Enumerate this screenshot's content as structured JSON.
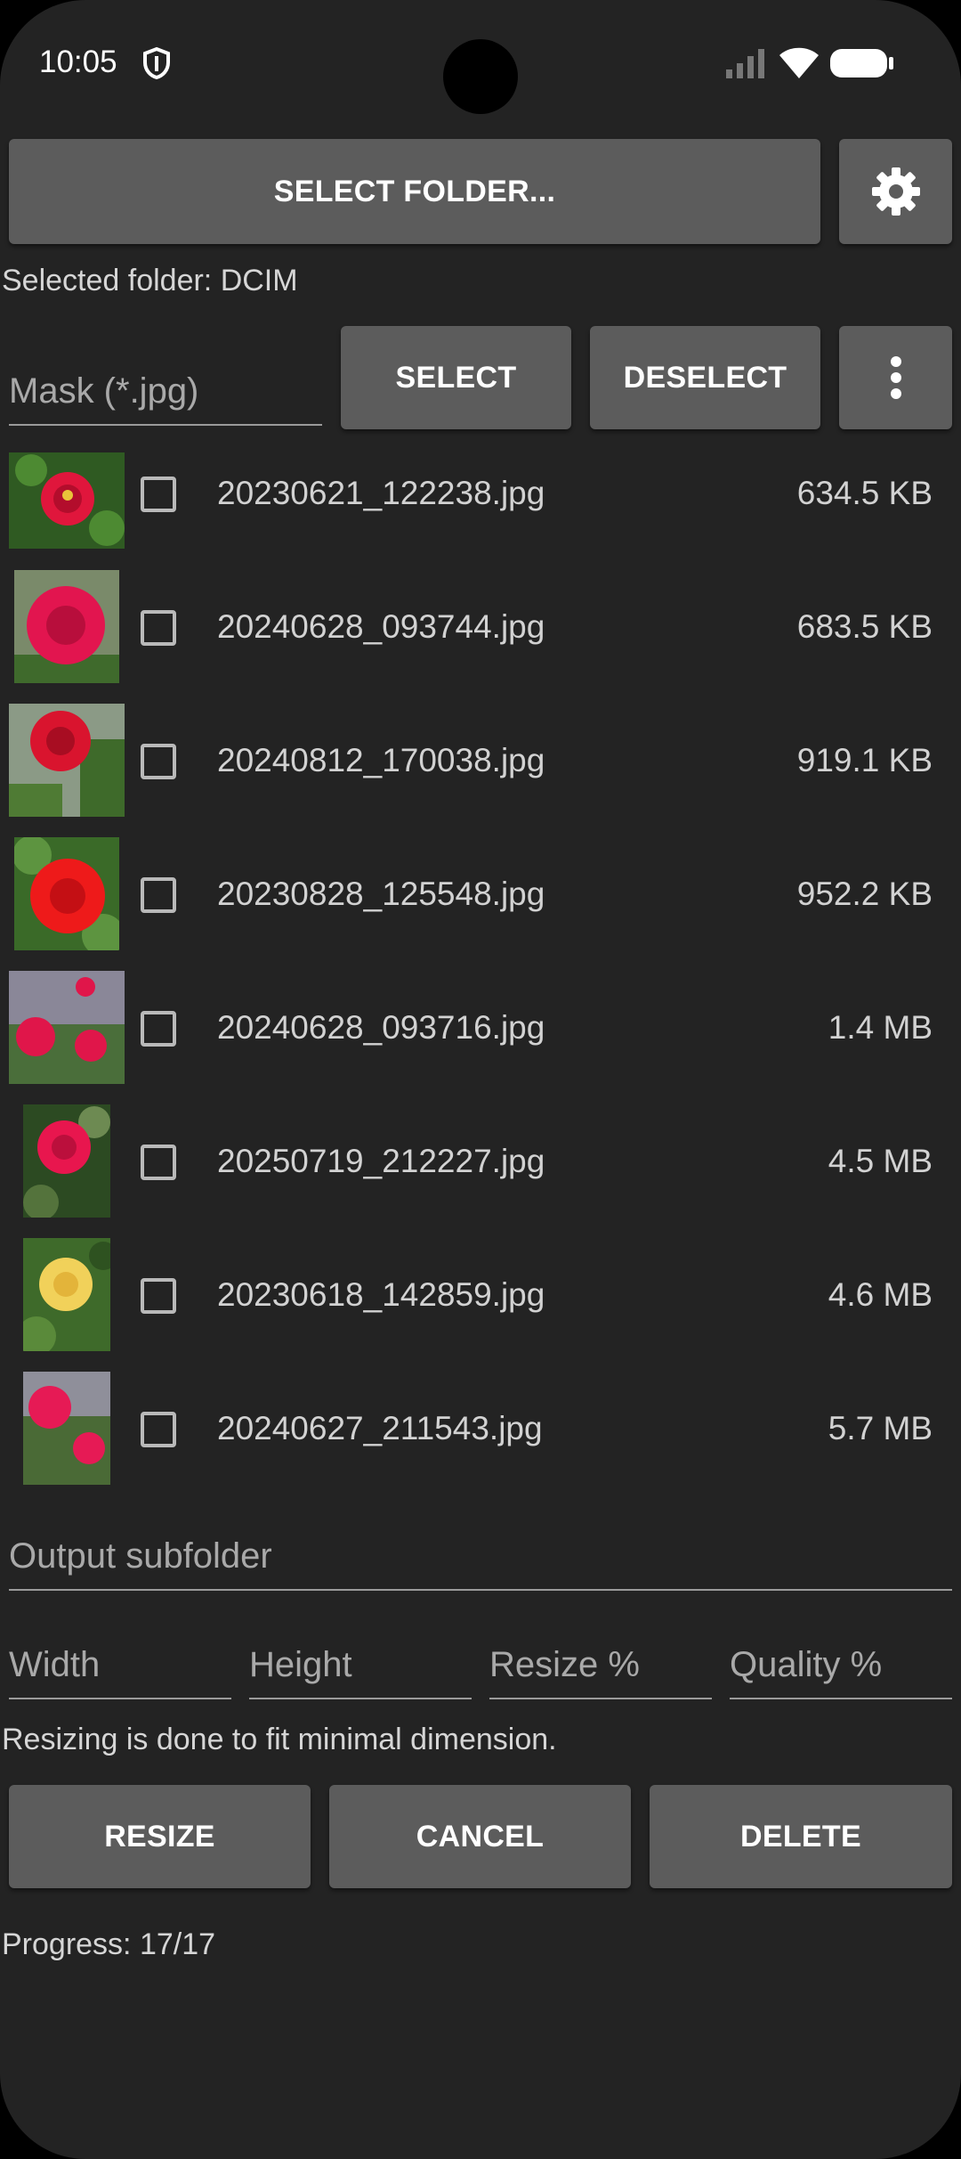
{
  "status_bar": {
    "time": "10:05"
  },
  "toolbar": {
    "select_folder_label": "SELECT FOLDER..."
  },
  "selected_folder_text": "Selected folder: DCIM",
  "mask": {
    "placeholder": "Mask (*.jpg)"
  },
  "buttons": {
    "select": "SELECT",
    "deselect": "DESELECT"
  },
  "files": [
    {
      "name": "20230621_122238.jpg",
      "size": "634.5 KB",
      "checked": false
    },
    {
      "name": "20240628_093744.jpg",
      "size": "683.5 KB",
      "checked": false
    },
    {
      "name": "20240812_170038.jpg",
      "size": "919.1 KB",
      "checked": false
    },
    {
      "name": "20230828_125548.jpg",
      "size": "952.2 KB",
      "checked": false
    },
    {
      "name": "20240628_093716.jpg",
      "size": "1.4 MB",
      "checked": false
    },
    {
      "name": "20250719_212227.jpg",
      "size": "4.5 MB",
      "checked": false
    },
    {
      "name": "20230618_142859.jpg",
      "size": "4.6 MB",
      "checked": false
    },
    {
      "name": "20240627_211543.jpg",
      "size": "5.7 MB",
      "checked": false
    }
  ],
  "output": {
    "subfolder_placeholder": "Output subfolder"
  },
  "params": {
    "width": "Width",
    "height": "Height",
    "resize": "Resize %",
    "quality": "Quality %"
  },
  "hint_text": "Resizing is done to fit minimal dimension.",
  "actions": {
    "resize": "RESIZE",
    "cancel": "CANCEL",
    "delete": "DELETE"
  },
  "progress_text": "Progress: 17/17",
  "colors": {
    "background": "#232323",
    "button": "#5c5c5c",
    "rose_red": "#e0163c",
    "rose_yellow": "#f1d15a",
    "foliage": "#3e6a2a"
  }
}
